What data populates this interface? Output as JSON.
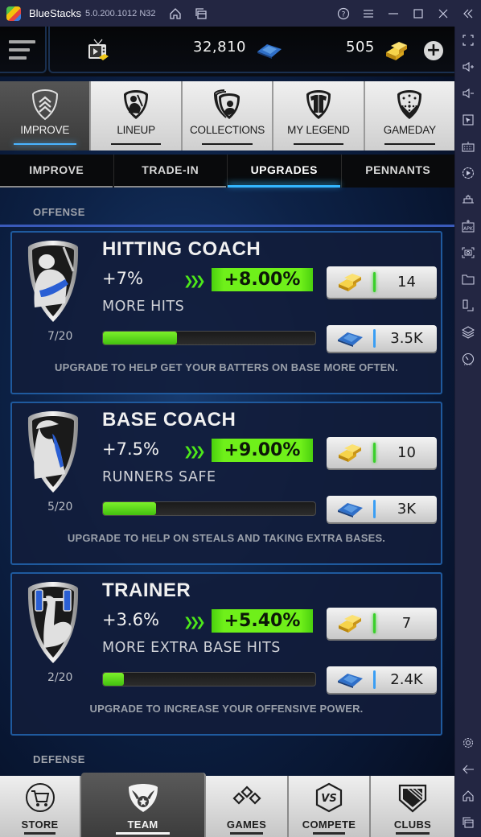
{
  "window": {
    "app_name": "BlueStacks",
    "version": "5.0.200.1012 N32"
  },
  "hud": {
    "cash": "32,810",
    "gold": "505",
    "menu_icon": "hamburger-icon",
    "tv_icon": "video-reward-icon",
    "add_icon": "plus-icon"
  },
  "top_nav": [
    {
      "label": "IMPROVE",
      "icon": "chevron-shield-icon",
      "active": true
    },
    {
      "label": "LINEUP",
      "icon": "batter-shield-icon",
      "active": false
    },
    {
      "label": "COLLECTIONS",
      "icon": "cards-shield-icon",
      "active": false
    },
    {
      "label": "MY LEGEND",
      "icon": "jersey-shield-icon",
      "active": false
    },
    {
      "label": "GAMEDAY",
      "icon": "diamond-shield-icon",
      "active": false
    }
  ],
  "sub_tabs": [
    {
      "label": "IMPROVE",
      "active": false
    },
    {
      "label": "TRADE-IN",
      "active": false
    },
    {
      "label": "UPGRADES",
      "active": true
    },
    {
      "label": "PENNANTS",
      "active": false
    }
  ],
  "sections": {
    "offense": "OFFENSE",
    "defense": "DEFENSE"
  },
  "upgrades": [
    {
      "title": "HITTING COACH",
      "current": "+7%",
      "next": "+8.00%",
      "subtitle": "MORE HITS",
      "level": "7/20",
      "progress": 0.35,
      "gold_cost": "14",
      "cash_cost": "3.5K",
      "description": "UPGRADE TO HELP GET YOUR BATTERS ON BASE MORE OFTEN.",
      "icon": "hitting-coach-shield-icon"
    },
    {
      "title": "BASE COACH",
      "current": "+7.5%",
      "next": "+9.00%",
      "subtitle": "RUNNERS SAFE",
      "level": "5/20",
      "progress": 0.25,
      "gold_cost": "10",
      "cash_cost": "3K",
      "description": "UPGRADE TO HELP ON STEALS AND TAKING EXTRA BASES.",
      "icon": "base-coach-shield-icon"
    },
    {
      "title": "TRAINER",
      "current": "+3.6%",
      "next": "+5.40%",
      "subtitle": "MORE EXTRA BASE HITS",
      "level": "2/20",
      "progress": 0.1,
      "gold_cost": "7",
      "cash_cost": "2.4K",
      "description": "UPGRADE TO INCREASE YOUR OFFENSIVE POWER.",
      "icon": "trainer-shield-icon"
    }
  ],
  "bottom_nav": [
    {
      "label": "STORE",
      "icon": "cart-icon",
      "active": false
    },
    {
      "label": "TEAM",
      "icon": "winged-shield-icon",
      "active": true
    },
    {
      "label": "GAMES",
      "icon": "diamonds-icon",
      "active": false
    },
    {
      "label": "COMPETE",
      "icon": "vs-icon",
      "active": false
    },
    {
      "label": "CLUBS",
      "icon": "home-plate-icon",
      "active": false
    }
  ],
  "colors": {
    "accent_blue": "#33b6ff",
    "upgrade_green": "#6ff01a",
    "card_border": "#1f5a9e",
    "bluestacks_bar": "#232642"
  }
}
